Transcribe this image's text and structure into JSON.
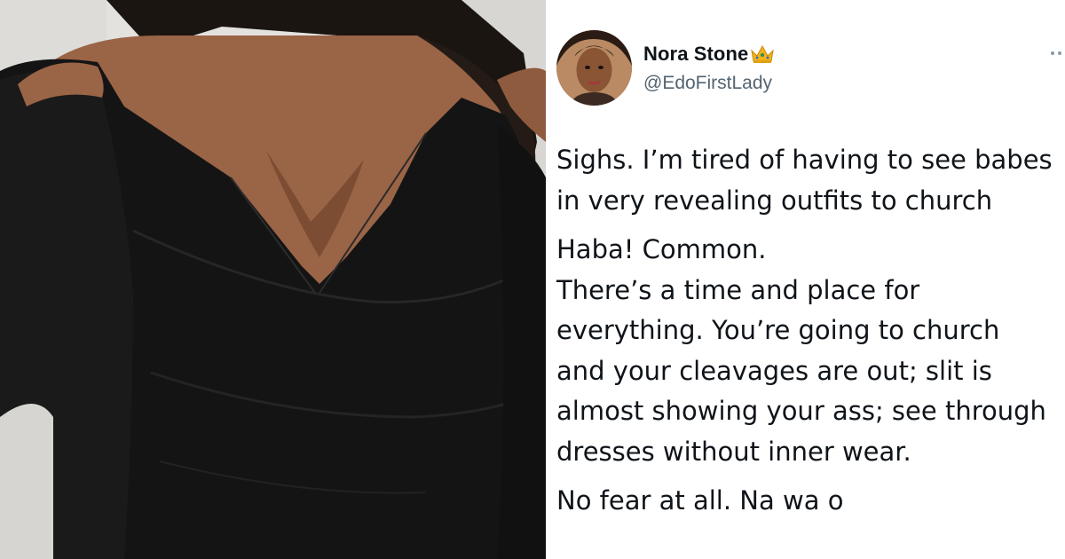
{
  "tweet": {
    "author": {
      "display_name": "Nora Stone",
      "handle": "@EdoFirstLady",
      "badge_icon": "crown-emoji-icon",
      "avatar_icon": "profile-avatar"
    },
    "more_icon": "more-options-icon",
    "paragraphs": [
      {
        "lines": [
          "Sighs. I’m tired of having to see babes",
          "in very revealing outfits to church"
        ]
      },
      {
        "lines": [
          "Haba! Common.",
          "There’s a time and place for",
          "everything. You’re going to church",
          "and your cleavages are out; slit is",
          "almost showing your ass; see through",
          "dresses without inner wear."
        ]
      },
      {
        "lines": [
          "No fear at all. Na wa o"
        ]
      }
    ]
  },
  "photo": {
    "description_icon": "photo-image",
    "colors": {
      "background": "#e7e5e2",
      "dress": "#141414",
      "skin": "#9a6446",
      "hair": "#1b1512"
    }
  },
  "colors": {
    "text_primary": "#0f1419",
    "text_secondary": "#536471",
    "crown": "#f2b21b"
  }
}
